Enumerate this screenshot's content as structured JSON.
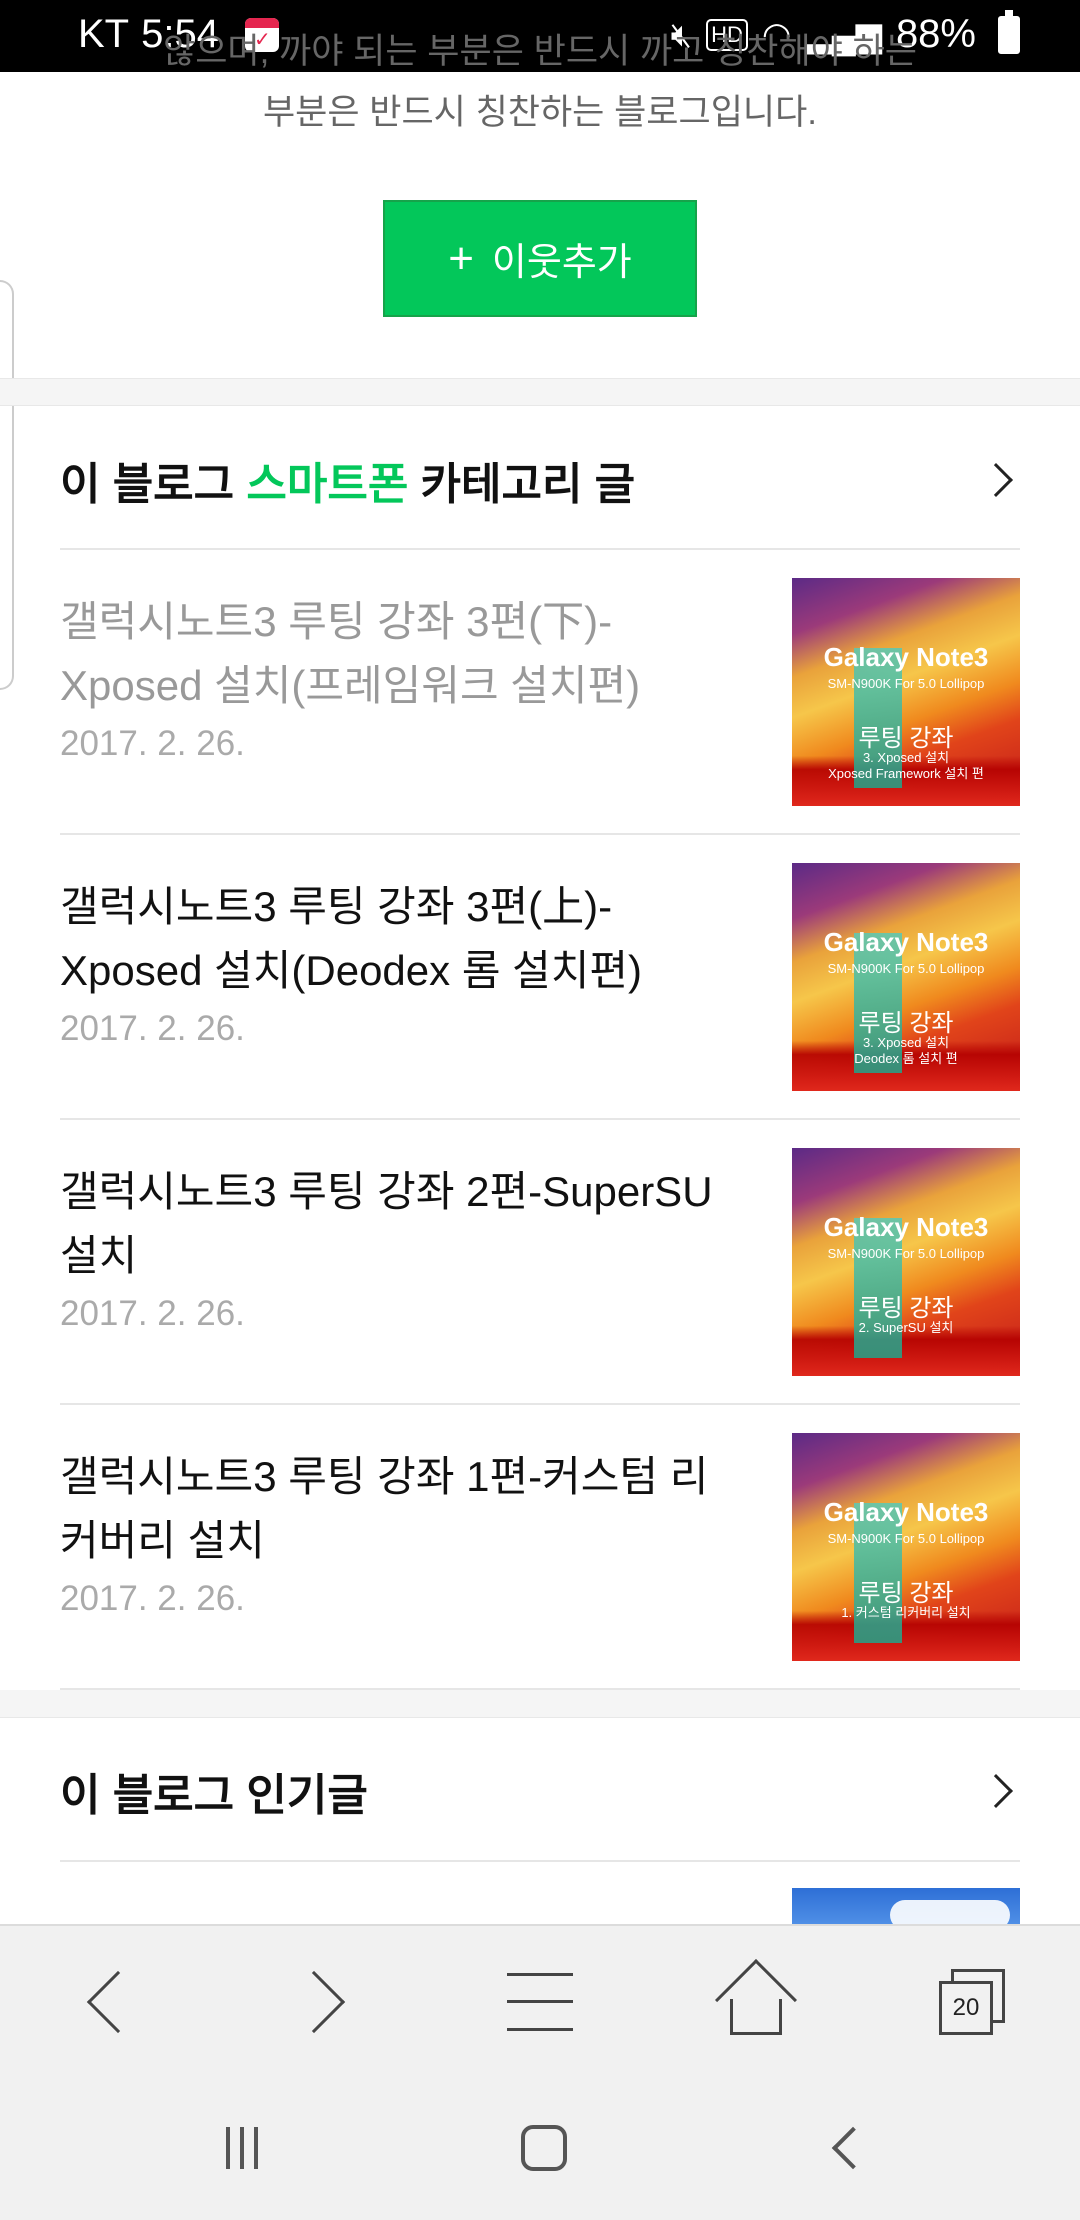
{
  "status_bar": {
    "carrier": "KT",
    "time": "5:54",
    "battery": "88%"
  },
  "intro": {
    "line1": "않으며, 까야 되는 부분은 반드시 까고 칭찬해야 하는",
    "line2": "부분은 반드시 칭찬하는 블로그입니다."
  },
  "add_neighbor": {
    "icon": "plus-icon",
    "label": "이웃추가"
  },
  "category_section": {
    "title_prefix": "이 블로그 ",
    "title_highlight": "스마트폰",
    "title_suffix": " 카테고리 글",
    "highlight_color": "#03c75a",
    "posts": [
      {
        "title": "갤럭시노트3 루팅 강좌 3편(下)-Xposed 설치(프레임워크 설치편)",
        "date": "2017. 2. 26.",
        "visited": true,
        "thumb": {
          "brand": "Galaxy Note3",
          "model": "SM-N900K For 5.0 Lollipop",
          "heading": "루팅 강좌",
          "sub1": "3. Xposed 설치",
          "sub2": "Xposed Framework 설치 편"
        }
      },
      {
        "title": "갤럭시노트3 루팅 강좌 3편(上)-Xposed 설치(Deodex 롬 설치편)",
        "date": "2017. 2. 26.",
        "visited": false,
        "thumb": {
          "brand": "Galaxy Note3",
          "model": "SM-N900K For 5.0 Lollipop",
          "heading": "루팅 강좌",
          "sub1": "3. Xposed 설치",
          "sub2": "Deodex 롬 설치 편"
        }
      },
      {
        "title": "갤럭시노트3 루팅 강좌 2편-SuperSU 설치",
        "date": "2017. 2. 26.",
        "visited": false,
        "thumb": {
          "brand": "Galaxy Note3",
          "model": "SM-N900K For 5.0 Lollipop",
          "heading": "루팅 강좌",
          "sub1": "2. SuperSU 설치",
          "sub2": ""
        }
      },
      {
        "title": "갤럭시노트3 루팅 강좌 1편-커스텀 리커버리 설치",
        "date": "2017. 2. 26.",
        "visited": false,
        "thumb": {
          "brand": "Galaxy Note3",
          "model": "SM-N900K For 5.0 Lollipop",
          "heading": "루팅 강좌",
          "sub1": "1. 커스텀 리커버리 설치",
          "sub2": ""
        }
      }
    ]
  },
  "popular_section": {
    "title": "이 블로그 인기글"
  },
  "toolbar": {
    "back_icon": "chevron-left-icon",
    "forward_icon": "chevron-right-icon",
    "menu_icon": "hamburger-icon",
    "home_icon": "home-icon",
    "tabs_icon": "tabs-icon",
    "tab_count": "20"
  },
  "navbar": {
    "recents_icon": "recents-icon",
    "home_icon": "home-circle-icon",
    "back_icon": "back-icon"
  }
}
